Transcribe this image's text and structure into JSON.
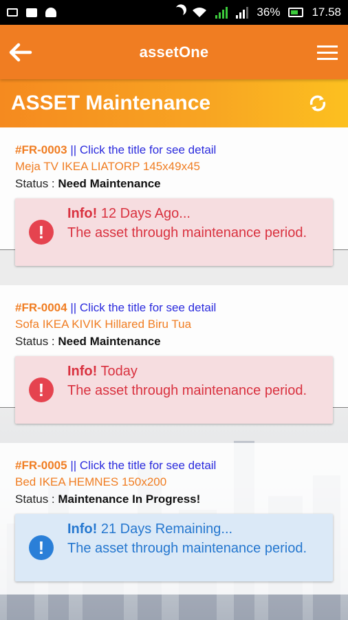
{
  "status_bar": {
    "battery": "36%",
    "time": "17.58",
    "network_label": "2"
  },
  "app_bar": {
    "title": "assetOne",
    "icons": [
      "back-arrow-icon",
      "hamburger-menu-icon"
    ]
  },
  "page": {
    "title": "ASSET Maintenance",
    "refresh_icon": "refresh-icon"
  },
  "colors": {
    "primary": "#f07d22",
    "header_gradient_end": "#fcc020",
    "link": "#2a2add",
    "warning_bg": "#f6dde0",
    "warning_text": "#d9313f",
    "info_bg": "#dbe9f7",
    "info_text": "#2577cf"
  },
  "assets": [
    {
      "code": "#FR-0003",
      "link_text": "|| Click the title for see detail",
      "name": "Meja TV IKEA LIATORP 145x49x45",
      "status_label": "Status :",
      "status_value": "Need Maintenance",
      "alert_type": "warning",
      "alert_strong": "Info!",
      "alert_time": "12 Days Ago...",
      "alert_text": "The asset through maintenance period."
    },
    {
      "code": "#FR-0004",
      "link_text": "|| Click the title for see detail",
      "name": "Sofa IKEA KIVIK Hillared Biru Tua",
      "status_label": "Status :",
      "status_value": "Need Maintenance",
      "alert_type": "warning",
      "alert_strong": "Info!",
      "alert_time": "Today",
      "alert_text": "The asset through maintenance period."
    },
    {
      "code": "#FR-0005",
      "link_text": "|| Click the title for see detail",
      "name": "Bed IKEA HEMNES 150x200",
      "status_label": "Status :",
      "status_value": "Maintenance In Progress!",
      "alert_type": "info",
      "alert_strong": "Info!",
      "alert_time": "21 Days Remaining...",
      "alert_text": "The asset through maintenance period."
    }
  ]
}
